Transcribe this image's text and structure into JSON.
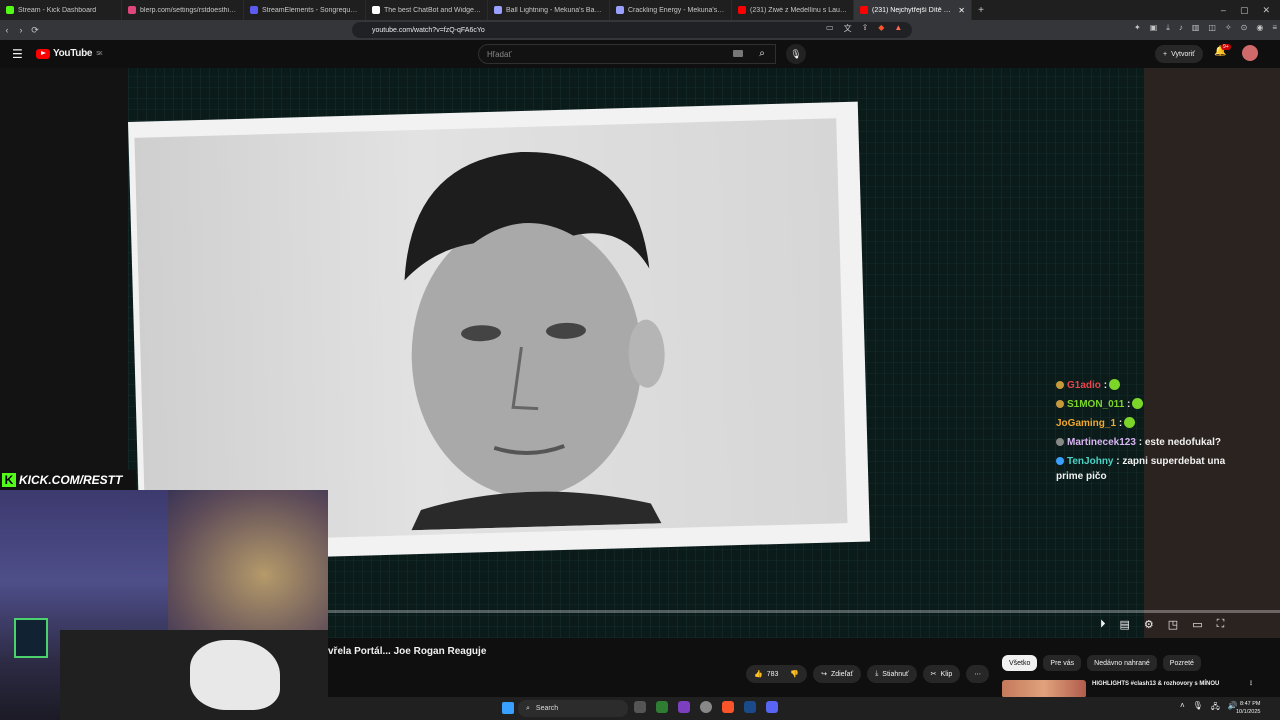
{
  "browser": {
    "tabs": [
      {
        "title": "Stream - Kick Dashboard",
        "color": "#53fc18"
      },
      {
        "title": "blerp.com/settings/rstdoesthings",
        "color": "#e0457b"
      },
      {
        "title": "StreamElements - Songrequest",
        "color": "#5b5bf0"
      },
      {
        "title": "The best ChatBot and Widgets for K",
        "color": "#ffffff"
      },
      {
        "title": "Ball Lightning - Mekuna's Ballkuna",
        "color": "#9aa0ff"
      },
      {
        "title": "Crackling Energy - Mekuna's Crackun",
        "color": "#9aa0ff"
      },
      {
        "title": "(231) Žiwé z Medellínu s Laurou. Kolu",
        "color": "#ff0000"
      },
      {
        "title": "(231) Nejchytřejší Dítě Světa Tvr",
        "color": "#ff0000",
        "active": true
      }
    ],
    "url": "youtube.com/watch?v=fzQ-qFA6cYo"
  },
  "youtube": {
    "logo_text": "YouTube",
    "region": "SK",
    "search_placeholder": "Hľadať",
    "create_label": "Vytvoriť",
    "notifications_badge": "9+"
  },
  "chat": [
    {
      "user": "G1adio",
      "text": ":",
      "color": "#e8454a",
      "emote": true
    },
    {
      "user": "S1MON_011",
      "text": ":",
      "color": "#7cd62a",
      "emote": true
    },
    {
      "user": "JoGaming_1",
      "text": ":",
      "color": "#f0a830",
      "emote": true
    },
    {
      "user": "Martinecek123",
      "text": ": este nedofukal?",
      "color": "#d8b4f0",
      "emote": false
    },
    {
      "user": "TenJohny",
      "text": ": zapni superdebat una prime pičo",
      "color": "#4ad2c6",
      "emote": false
    }
  ],
  "overlay": {
    "kick_handle": "KICK.COM/RESTT"
  },
  "video": {
    "title": "vřela Portál... Joe Rogan Reaguje",
    "likes": "783",
    "share_label": "Zdieľať",
    "download_label": "Stiahnuť",
    "clip_label": "Klip"
  },
  "sidebar": {
    "chips": [
      "Všetko",
      "Pre vás",
      "Nedávno nahrané",
      "Pozreté"
    ],
    "first_reco_title": "HIGHLIGHTS #clash13 & rozhovory s MÍNOU"
  },
  "taskbar": {
    "search_label": "Search",
    "time": "8:47 PM",
    "date": "10/1/2025"
  }
}
